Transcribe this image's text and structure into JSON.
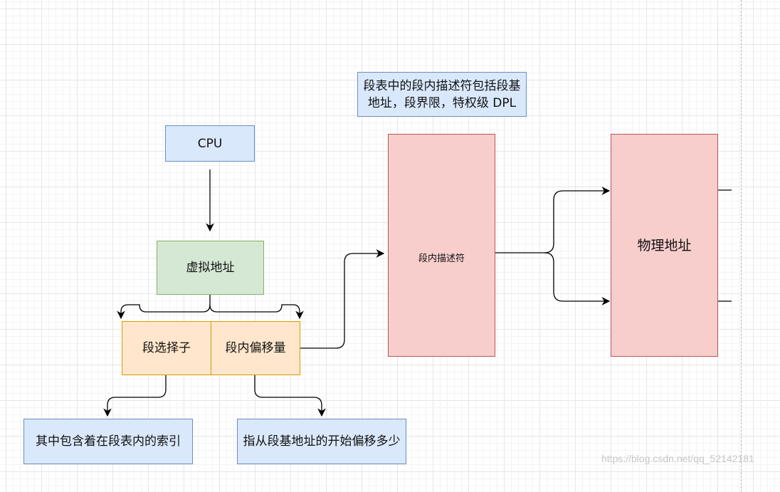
{
  "nodes": {
    "cpu": "CPU",
    "virtual_address": "虚拟地址",
    "segment_selector": "段选择子",
    "segment_offset": "段内偏移量",
    "selector_note": "其中包含着在段表内的索引",
    "offset_note": "指从段基地址的开始偏移多少",
    "descriptor_note": "段表中的段内描述符包括段基地址，段界限，特权级 DPL",
    "segment_descriptor": "段内描述符",
    "physical_address": "物理地址"
  },
  "watermark": "https://blog.csdn.net/qq_52142181",
  "colors": {
    "blue_fill": "#dae8fc",
    "green_fill": "#d5e8d4",
    "orange_fill": "#ffe6cc",
    "red_fill": "#f8cecc",
    "descriptor_arrow": "#3b00c7"
  }
}
